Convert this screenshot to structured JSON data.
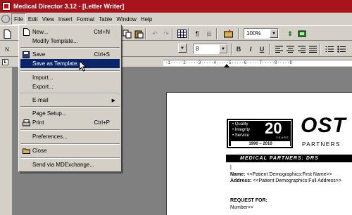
{
  "title": "Medical Director 3.12 - [Letter Writer]",
  "menubar": [
    "File",
    "Edit",
    "View",
    "Insert",
    "Format",
    "Table",
    "Window",
    "Help"
  ],
  "toolbar": {
    "zoom": "100%",
    "font_size": "8",
    "format_buttons": [
      "B",
      "I",
      "U"
    ]
  },
  "ruler_text": "·1·····2·····3·····4·····5·····6·····7·····8·····9",
  "file_menu": {
    "items": [
      {
        "label": "New...",
        "shortcut": "Ctrl+N",
        "icon": "new-document-icon"
      },
      {
        "label": "Modify Template...",
        "shortcut": ""
      },
      {
        "label": "Save",
        "shortcut": "Ctrl+S",
        "icon": "save-icon"
      },
      {
        "label": "Save as Template...",
        "shortcut": "",
        "highlighted": true
      },
      {
        "label": "Import...",
        "shortcut": ""
      },
      {
        "label": "Export...",
        "shortcut": ""
      },
      {
        "label": "E-mail",
        "shortcut": "",
        "submenu": true
      },
      {
        "label": "Page Setup...",
        "shortcut": ""
      },
      {
        "label": "Print",
        "shortcut": "Ctrl+P",
        "icon": "print-icon"
      },
      {
        "label": "Preferences...",
        "shortcut": ""
      },
      {
        "label": "Close",
        "shortcut": "",
        "icon": "close-folder-icon"
      },
      {
        "label": "Send via MDExchange...",
        "shortcut": ""
      }
    ]
  },
  "document": {
    "badge_items": [
      "• Quality",
      "• Integrity",
      "• Service"
    ],
    "badge_number": "20",
    "badge_years": "YEARS",
    "badge_range": "1990 – 2010",
    "logo_text": "OST",
    "partners_text": "PARTNERS",
    "banner_text": "MEDICAL PARTNERS: DRS",
    "name_label": "Name:",
    "name_value": "<<Patient Demographics:First Name>>",
    "address_label": "Address:",
    "address_value": "<<Patient Demographics:Full Address>>",
    "request_label": "REQUEST FOR:",
    "number_text": "Number>>"
  },
  "colors": {
    "titlebar": "#a8141c",
    "highlight": "#0a246a",
    "chrome": "#d4d0c8",
    "workspace": "#808080"
  }
}
